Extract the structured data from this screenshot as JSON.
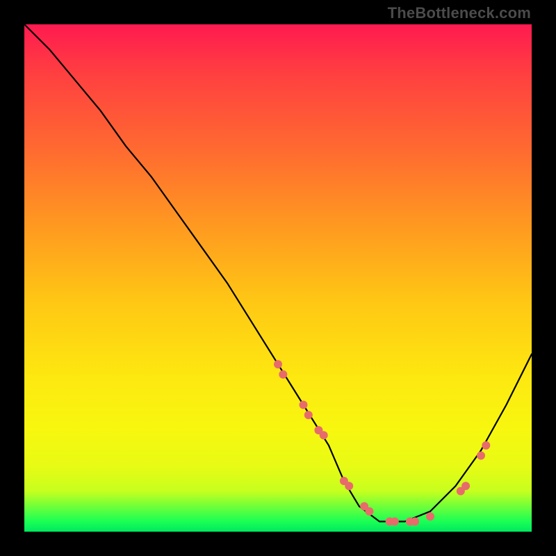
{
  "watermark": "TheBottleneck.com",
  "chart_data": {
    "type": "line",
    "title": "",
    "xlabel": "",
    "ylabel": "",
    "xlim": [
      0,
      100
    ],
    "ylim": [
      0,
      100
    ],
    "curve": {
      "name": "bottleneck-curve",
      "x": [
        0,
        5,
        10,
        15,
        20,
        25,
        30,
        35,
        40,
        45,
        50,
        55,
        60,
        63,
        66,
        70,
        75,
        80,
        85,
        90,
        95,
        100
      ],
      "y": [
        100,
        95,
        89,
        83,
        76,
        70,
        63,
        56,
        49,
        41,
        33,
        25,
        17,
        10,
        5,
        2,
        2,
        4,
        9,
        16,
        25,
        35
      ]
    },
    "markers": {
      "name": "highlight-points",
      "color": "#e86b6b",
      "x": [
        50,
        51,
        55,
        56,
        58,
        59,
        63,
        64,
        67,
        68,
        72,
        73,
        76,
        77,
        80,
        86,
        87,
        90,
        91
      ],
      "y": [
        33,
        31,
        25,
        23,
        20,
        19,
        10,
        9,
        5,
        4,
        2,
        2,
        2,
        2,
        3,
        8,
        9,
        15,
        17
      ]
    }
  }
}
